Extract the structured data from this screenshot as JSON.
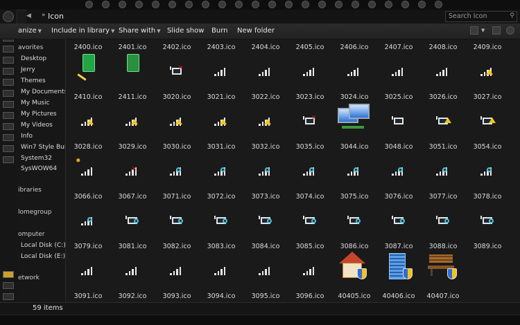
{
  "addressbar": {
    "breadcrumb_arrow": "»",
    "current_folder": "Icon",
    "search_placeholder": "Search Icon"
  },
  "toolbar": {
    "organize": "anize",
    "include_in_library": "Include in library",
    "share_with": "Share with",
    "slide_show": "Slide show",
    "burn": "Burn",
    "new_folder": "New folder"
  },
  "navpane": {
    "favorites": "avorites",
    "desktop": "Desktop",
    "jerry": "Jerry",
    "themes": "Themes",
    "my_documents": "My Documents",
    "my_music": "My Music",
    "my_pictures": "My Pictures",
    "my_videos": "My Videos",
    "info": "Info",
    "win7_style_bui": "Win7 Style Bui",
    "system32": "System32",
    "syswow64": "SysWOW64",
    "libraries": "ibraries",
    "homegroup": "lomegroup",
    "computer": "omputer",
    "local_disk_c": "Local Disk (C:)",
    "local_disk_e": "Local Disk (E:)",
    "network": "etwork"
  },
  "files": [
    {
      "name": "2400.ico",
      "icon": "partial-icon"
    },
    {
      "name": "2401.ico",
      "icon": "partial-icon"
    },
    {
      "name": "2402.ico",
      "icon": "partial-icon"
    },
    {
      "name": "2403.ico",
      "icon": "partial-icon"
    },
    {
      "name": "2404.ico",
      "icon": "partial-icon"
    },
    {
      "name": "2405.ico",
      "icon": "partial-icon"
    },
    {
      "name": "2406.ico",
      "icon": "partial-icon"
    },
    {
      "name": "2407.ico",
      "icon": "partial-icon"
    },
    {
      "name": "2408.ico",
      "icon": "partial-icon"
    },
    {
      "name": "2409.ico",
      "icon": "partial-icon"
    },
    {
      "name": "2410.ico",
      "icon": "green-book-pencil-icon"
    },
    {
      "name": "2411.ico",
      "icon": "green-book-icon"
    },
    {
      "name": "3020.ico",
      "icon": "network-x-icon"
    },
    {
      "name": "3021.ico",
      "icon": "signal-icon"
    },
    {
      "name": "3022.ico",
      "icon": "signal-icon"
    },
    {
      "name": "3023.ico",
      "icon": "signal-icon"
    },
    {
      "name": "3024.ico",
      "icon": "signal-icon"
    },
    {
      "name": "3025.ico",
      "icon": "signal-icon"
    },
    {
      "name": "3026.ico",
      "icon": "signal-icon"
    },
    {
      "name": "3027.ico",
      "icon": "signal-warning-icon"
    },
    {
      "name": "3028.ico",
      "icon": "signal-warning-icon"
    },
    {
      "name": "3029.ico",
      "icon": "signal-warning-icon"
    },
    {
      "name": "3030.ico",
      "icon": "signal-warning-icon"
    },
    {
      "name": "3031.ico",
      "icon": "signal-warning-icon"
    },
    {
      "name": "3032.ico",
      "icon": "signal-warning-icon"
    },
    {
      "name": "3035.ico",
      "icon": "network-x-icon"
    },
    {
      "name": "3044.ico",
      "icon": "network-computers-icon"
    },
    {
      "name": "3048.ico",
      "icon": "network-icon"
    },
    {
      "name": "3051.ico",
      "icon": "network-warning-icon"
    },
    {
      "name": "3054.ico",
      "icon": "network-warning-icon"
    },
    {
      "name": "3066.ico",
      "icon": "signal-star-icon"
    },
    {
      "name": "3067.ico",
      "icon": "signal-x-icon"
    },
    {
      "name": "3071.ico",
      "icon": "signal-globe-icon"
    },
    {
      "name": "3072.ico",
      "icon": "signal-globe-icon"
    },
    {
      "name": "3073.ico",
      "icon": "signal-globe-icon"
    },
    {
      "name": "3074.ico",
      "icon": "signal-globe-icon"
    },
    {
      "name": "3075.ico",
      "icon": "signal-globe-icon"
    },
    {
      "name": "3076.ico",
      "icon": "signal-globe-icon"
    },
    {
      "name": "3077.ico",
      "icon": "signal-globe-icon"
    },
    {
      "name": "3078.ico",
      "icon": "signal-globe-icon"
    },
    {
      "name": "3079.ico",
      "icon": "signal-globe-icon"
    },
    {
      "name": "3081.ico",
      "icon": "network-globe-icon"
    },
    {
      "name": "3082.ico",
      "icon": "network-globe-icon"
    },
    {
      "name": "3083.ico",
      "icon": "network-globe-icon"
    },
    {
      "name": "3084.ico",
      "icon": "network-globe-icon"
    },
    {
      "name": "3085.ico",
      "icon": "network-globe-icon"
    },
    {
      "name": "3086.ico",
      "icon": "network-globe-icon"
    },
    {
      "name": "3087.ico",
      "icon": "network-globe-icon"
    },
    {
      "name": "3088.ico",
      "icon": "network-globe-icon"
    },
    {
      "name": "3089.ico",
      "icon": "network-globe-icon"
    },
    {
      "name": "3091.ico",
      "icon": "signal-icon"
    },
    {
      "name": "3092.ico",
      "icon": "signal-icon"
    },
    {
      "name": "3093.ico",
      "icon": "signal-icon"
    },
    {
      "name": "3094.ico",
      "icon": "signal-icon"
    },
    {
      "name": "3095.ico",
      "icon": "signal-icon"
    },
    {
      "name": "3096.ico",
      "icon": "signal-icon"
    },
    {
      "name": "40405.ico",
      "icon": "house-shield-icon"
    },
    {
      "name": "40406.ico",
      "icon": "building-shield-icon"
    },
    {
      "name": "40407.ico",
      "icon": "bench-shield-icon"
    }
  ],
  "status": {
    "item_count": "59 items"
  }
}
